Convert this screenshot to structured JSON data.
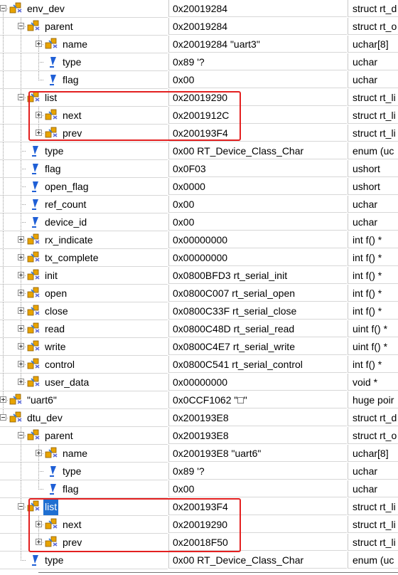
{
  "watch": {
    "rows": [
      {
        "name": "env_dev",
        "value": "0x20019284",
        "type": "struct rt_d",
        "depth": 0,
        "toggle": "minus",
        "icon": "struct"
      },
      {
        "name": "parent",
        "value": "0x20019284",
        "type": "struct rt_o",
        "depth": 1,
        "toggle": "minus",
        "icon": "struct"
      },
      {
        "name": "name",
        "value": "0x20019284 \"uart3\"",
        "type": "uchar[8]",
        "depth": 2,
        "toggle": "plus",
        "icon": "struct"
      },
      {
        "name": "type",
        "value": "0x89 '?",
        "type": "uchar",
        "depth": 2,
        "toggle": "none",
        "icon": "field"
      },
      {
        "name": "flag",
        "value": "0x00",
        "type": "uchar",
        "depth": 2,
        "toggle": "none",
        "icon": "field"
      },
      {
        "name": "list",
        "value": "0x20019290",
        "type": "struct rt_li",
        "depth": 1,
        "toggle": "minus",
        "icon": "struct"
      },
      {
        "name": "next",
        "value": "0x2001912C",
        "type": "struct rt_li",
        "depth": 2,
        "toggle": "plus",
        "icon": "struct"
      },
      {
        "name": "prev",
        "value": "0x200193F4",
        "type": "struct rt_li",
        "depth": 2,
        "toggle": "plus",
        "icon": "struct"
      },
      {
        "name": "type",
        "value": "0x00 RT_Device_Class_Char",
        "type": "enum (uc",
        "depth": 1,
        "toggle": "none",
        "icon": "field"
      },
      {
        "name": "flag",
        "value": "0x0F03",
        "type": "ushort",
        "depth": 1,
        "toggle": "none",
        "icon": "field"
      },
      {
        "name": "open_flag",
        "value": "0x0000",
        "type": "ushort",
        "depth": 1,
        "toggle": "none",
        "icon": "field"
      },
      {
        "name": "ref_count",
        "value": "0x00",
        "type": "uchar",
        "depth": 1,
        "toggle": "none",
        "icon": "field"
      },
      {
        "name": "device_id",
        "value": "0x00",
        "type": "uchar",
        "depth": 1,
        "toggle": "none",
        "icon": "field"
      },
      {
        "name": "rx_indicate",
        "value": "0x00000000",
        "type": "int f()  *",
        "depth": 1,
        "toggle": "plus",
        "icon": "struct"
      },
      {
        "name": "tx_complete",
        "value": "0x00000000",
        "type": "int f()  *",
        "depth": 1,
        "toggle": "plus",
        "icon": "struct"
      },
      {
        "name": "init",
        "value": "0x0800BFD3 rt_serial_init",
        "type": "int f()  *",
        "depth": 1,
        "toggle": "plus",
        "icon": "struct"
      },
      {
        "name": "open",
        "value": "0x0800C007 rt_serial_open",
        "type": "int f()  *",
        "depth": 1,
        "toggle": "plus",
        "icon": "struct"
      },
      {
        "name": "close",
        "value": "0x0800C33F rt_serial_close",
        "type": "int f()  *",
        "depth": 1,
        "toggle": "plus",
        "icon": "struct"
      },
      {
        "name": "read",
        "value": "0x0800C48D rt_serial_read",
        "type": "uint f()  *",
        "depth": 1,
        "toggle": "plus",
        "icon": "struct"
      },
      {
        "name": "write",
        "value": "0x0800C4E7 rt_serial_write",
        "type": "uint f()  *",
        "depth": 1,
        "toggle": "plus",
        "icon": "struct"
      },
      {
        "name": "control",
        "value": "0x0800C541 rt_serial_control",
        "type": "int f()  *",
        "depth": 1,
        "toggle": "plus",
        "icon": "struct"
      },
      {
        "name": "user_data",
        "value": "0x00000000",
        "type": "void *",
        "depth": 1,
        "toggle": "plus",
        "icon": "struct"
      },
      {
        "name": "\"uart6\"",
        "value": "0x0CCF1062 \"□\"",
        "type": "huge poir",
        "depth": 0,
        "toggle": "plus",
        "icon": "struct"
      },
      {
        "name": "dtu_dev",
        "value": "0x200193E8",
        "type": "struct rt_d",
        "depth": 0,
        "toggle": "minus",
        "icon": "struct"
      },
      {
        "name": "parent",
        "value": "0x200193E8",
        "type": "struct rt_o",
        "depth": 1,
        "toggle": "minus",
        "icon": "struct"
      },
      {
        "name": "name",
        "value": "0x200193E8 \"uart6\"",
        "type": "uchar[8]",
        "depth": 2,
        "toggle": "plus",
        "icon": "struct"
      },
      {
        "name": "type",
        "value": "0x89 '?",
        "type": "uchar",
        "depth": 2,
        "toggle": "none",
        "icon": "field"
      },
      {
        "name": "flag",
        "value": "0x00",
        "type": "uchar",
        "depth": 2,
        "toggle": "none",
        "icon": "field"
      },
      {
        "name": "list",
        "value": "0x200193F4",
        "type": "struct rt_li",
        "depth": 1,
        "toggle": "minus",
        "icon": "struct",
        "selected": true
      },
      {
        "name": "next",
        "value": "0x20019290",
        "type": "struct rt_li",
        "depth": 2,
        "toggle": "plus",
        "icon": "struct"
      },
      {
        "name": "prev",
        "value": "0x20018F50",
        "type": "struct rt_li",
        "depth": 2,
        "toggle": "plus",
        "icon": "struct"
      },
      {
        "name": "type",
        "value": "0x00 RT_Device_Class_Char",
        "type": "enum (uc",
        "depth": 1,
        "toggle": "none",
        "icon": "field"
      }
    ]
  },
  "colors": {
    "selection": "#1f6fd1",
    "highlight_box": "#e32020",
    "struct_icon": "#e8a400",
    "field_icon": "#1f5fd6"
  }
}
